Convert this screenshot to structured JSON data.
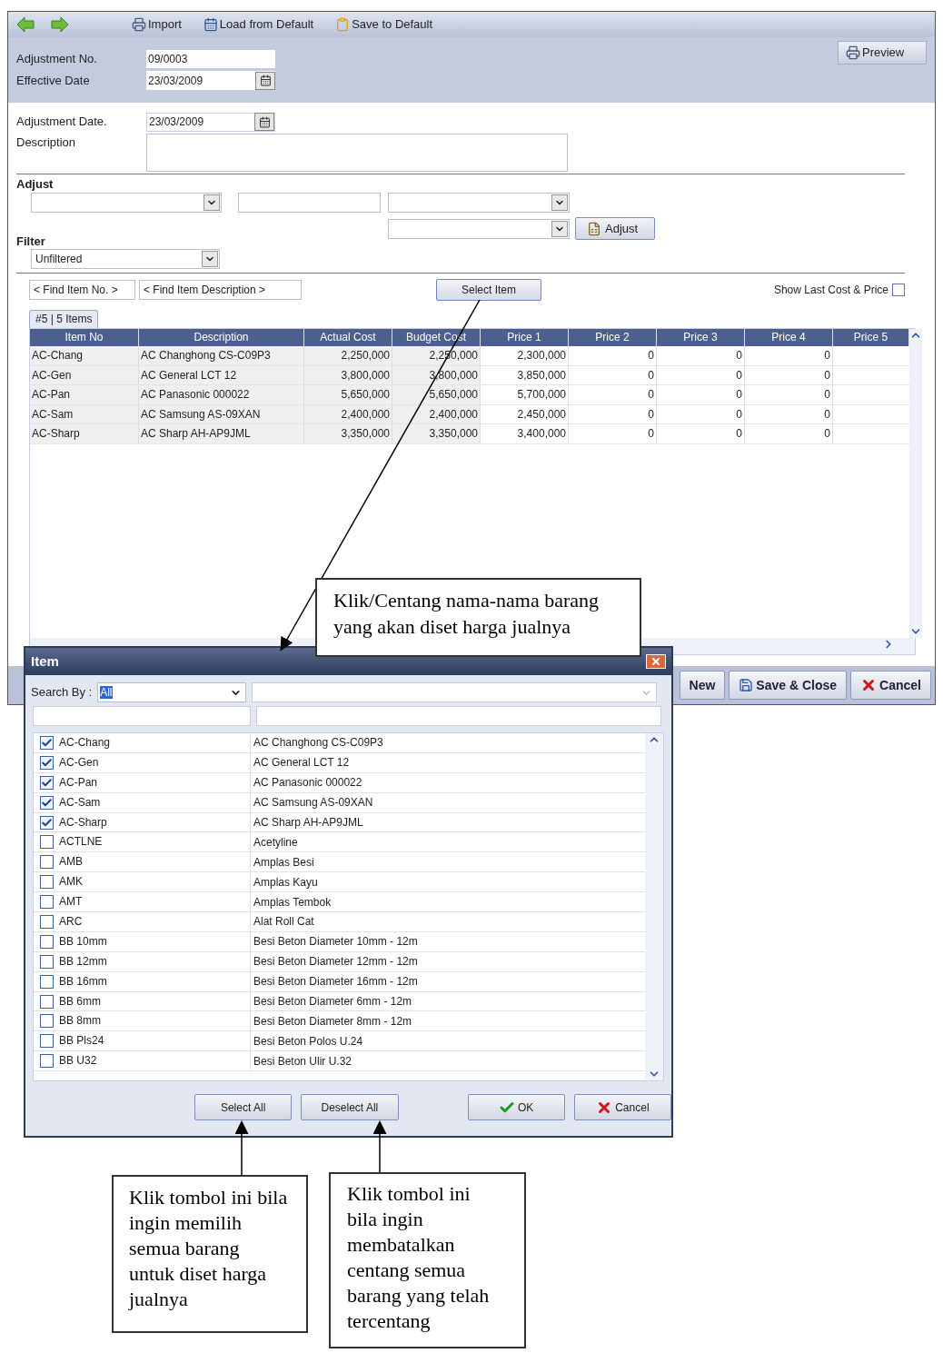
{
  "toolbar": [
    {
      "kind": "back"
    },
    {
      "kind": "forward"
    },
    {
      "kind": "printer",
      "label": "Import"
    },
    {
      "kind": "calendar",
      "label": "Load from Default"
    },
    {
      "kind": "clipboard",
      "label": "Save to Default"
    }
  ],
  "header": {
    "fields": [
      {
        "label": "Adjustment No.",
        "value": "09/0003",
        "kind": "text"
      },
      {
        "label": "Effective Date",
        "value": "23/03/2009",
        "kind": "date"
      }
    ],
    "preview_button": "Preview"
  },
  "form": {
    "adjustment_date": {
      "label": "Adjustment Date.",
      "value": "23/03/2009"
    },
    "description": {
      "label": "Description"
    }
  },
  "adjust": {
    "title": "Adjust",
    "button": "Adjust"
  },
  "filter": {
    "title": "Filter",
    "value": "Unfiltered"
  },
  "find_item_no": {
    "value": "< Find Item No. >"
  },
  "find_item_description": {
    "value": "< Find Item Description >"
  },
  "select_item_button": "Select Item",
  "show_last_cost": {
    "label": "Show Last Cost & Price",
    "checked": false
  },
  "tab": {
    "label": "#5 | 5 Items",
    "selected": true
  },
  "table": {
    "columns": [
      "Item No",
      "Description",
      "Actual Cost",
      "Budget Cost",
      "Price 1",
      "Price 2",
      "Price 3",
      "Price 4",
      "Price 5"
    ],
    "rows": [
      [
        "AC-Chang",
        "AC Changhong CS-C09P3",
        "2,250,000",
        "2,250,000",
        "2,300,000",
        "0",
        "0",
        "0"
      ],
      [
        "AC-Gen",
        "AC General LCT 12",
        "3,800,000",
        "3,800,000",
        "3,850,000",
        "0",
        "0",
        "0"
      ],
      [
        "AC-Pan",
        "AC Panasonic 000022",
        "5,650,000",
        "5,650,000",
        "5,700,000",
        "0",
        "0",
        "0"
      ],
      [
        "AC-Sam",
        "AC Samsung AS-09XAN",
        "2,400,000",
        "2,400,000",
        "2,450,000",
        "0",
        "0",
        "0"
      ],
      [
        "AC-Sharp",
        "AC Sharp AH-AP9JML",
        "3,350,000",
        "3,350,000",
        "3,400,000",
        "0",
        "0",
        "0"
      ]
    ]
  },
  "bottom_buttons": [
    {
      "label": "New",
      "kind": "plain"
    },
    {
      "label": "Save & Close",
      "kind": "save"
    },
    {
      "label": "Cancel",
      "kind": "cancel"
    }
  ],
  "dialog": {
    "title": "Item",
    "search_by_label": "Search By :",
    "search_by_value": "All",
    "items": [
      {
        "code": "AC-Chang",
        "description": "AC Changhong CS-C09P3",
        "checked": true
      },
      {
        "code": "AC-Gen",
        "description": "AC General LCT 12",
        "checked": true
      },
      {
        "code": "AC-Pan",
        "description": "AC Panasonic 000022",
        "checked": true
      },
      {
        "code": "AC-Sam",
        "description": "AC Samsung AS-09XAN",
        "checked": true
      },
      {
        "code": "AC-Sharp",
        "description": "AC Sharp AH-AP9JML",
        "checked": true
      },
      {
        "code": "ACTLNE",
        "description": "Acetyline",
        "checked": false
      },
      {
        "code": "AMB",
        "description": "Amplas Besi",
        "checked": false
      },
      {
        "code": "AMK",
        "description": "Amplas Kayu",
        "checked": false
      },
      {
        "code": "AMT",
        "description": "Amplas Tembok",
        "checked": false
      },
      {
        "code": "ARC",
        "description": "Alat Roll Cat",
        "checked": false
      },
      {
        "code": "BB 10mm",
        "description": "Besi Beton Diameter 10mm - 12m",
        "checked": false
      },
      {
        "code": "BB 12mm",
        "description": "Besi Beton Diameter 12mm - 12m",
        "checked": false
      },
      {
        "code": "BB 16mm",
        "description": "Besi Beton Diameter 16mm - 12m",
        "checked": false
      },
      {
        "code": "BB 6mm",
        "description": "Besi Beton Diameter 6mm - 12m",
        "checked": false
      },
      {
        "code": "BB 8mm",
        "description": "Besi Beton Diameter 8mm - 12m",
        "checked": false
      },
      {
        "code": "BB Pls24",
        "description": "Besi Beton Polos U.24",
        "checked": false
      },
      {
        "code": "BB U32",
        "description": "Besi Beton Ulir U.32",
        "checked": false
      }
    ],
    "buttons": [
      {
        "label": "Select All",
        "kind": "plain"
      },
      {
        "label": "Deselect All",
        "kind": "plain"
      },
      {
        "label": "OK",
        "kind": "ok"
      },
      {
        "label": "Cancel",
        "kind": "cancel"
      }
    ]
  },
  "callouts": [
    {
      "text": "Klik/Centang nama-nama barang yang akan diset harga jualnya"
    },
    {
      "text": "Klik tombol ini bila ingin memilih semua barang untuk diset harga jualnya"
    },
    {
      "text": "Klik tombol ini bila ingin membatalkan centang semua barang yang telah tercentang"
    }
  ]
}
